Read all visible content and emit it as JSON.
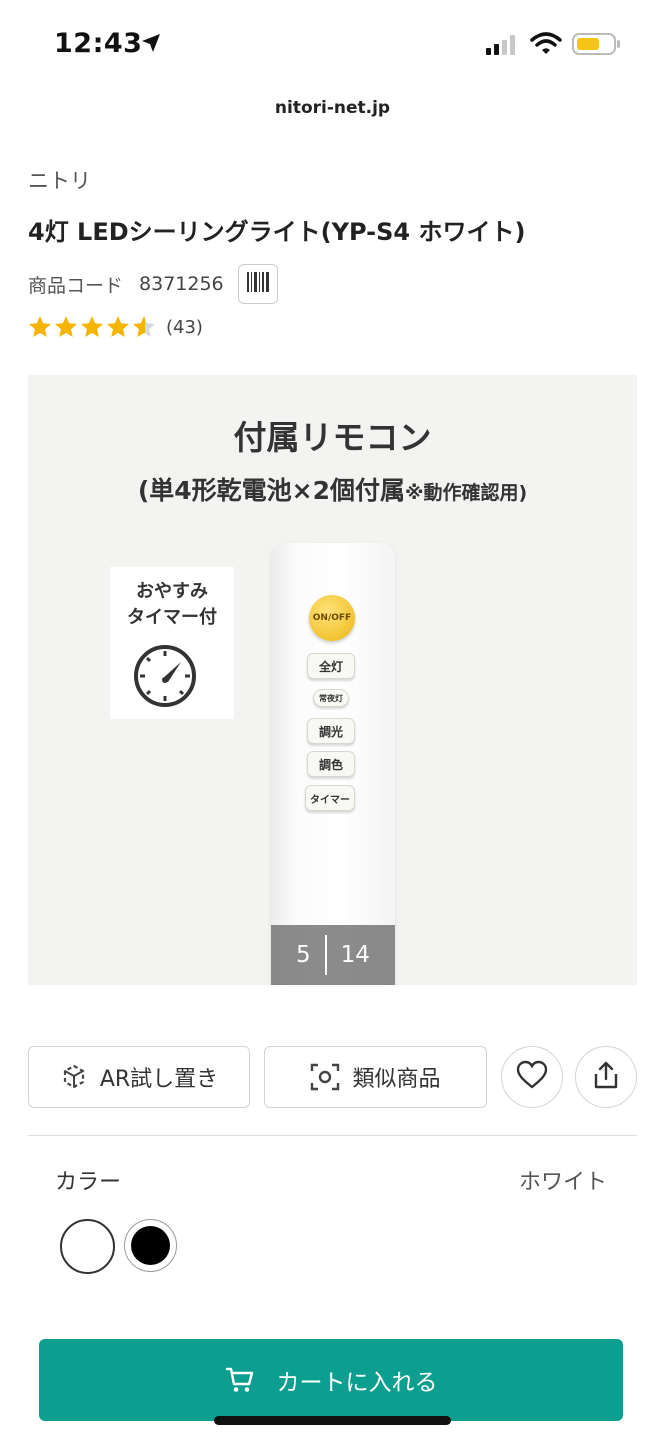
{
  "status_bar": {
    "time": "12:43",
    "icons": [
      "location-arrow-icon",
      "signal-icon",
      "wifi-icon",
      "battery-icon"
    ]
  },
  "browser": {
    "url": "nitori-net.jp"
  },
  "product": {
    "brand": "ニトリ",
    "title": "4灯 LEDシーリングライト(YP-S4 ホワイト)",
    "code_label": "商品コード",
    "code_value": "8371256",
    "rating": 4.5,
    "rating_count": "(43)"
  },
  "image": {
    "heading": "付属リモコン",
    "subheading": "(単4形乾電池×2個付属",
    "subheading_note": "※動作確認用)",
    "timer_badge_line1": "おやすみ",
    "timer_badge_line2": "タイマー付",
    "remote_buttons": {
      "on_off": "ON/OFF",
      "full": "全灯",
      "night": "常夜灯",
      "dimming": "調光",
      "color": "調色",
      "timer": "タイマー"
    },
    "current_index": "5",
    "total": "14"
  },
  "actions": {
    "ar_label": "AR試し置き",
    "similar_label": "類似商品"
  },
  "color": {
    "label": "カラー",
    "selected": "ホワイト",
    "swatches": [
      {
        "name": "white",
        "hex": "#ffffff",
        "selected": true
      },
      {
        "name": "black",
        "hex": "#000000",
        "selected": false
      }
    ]
  },
  "cart": {
    "label": "カートに入れる"
  },
  "colors": {
    "accent": "#0c9f8f",
    "star": "#f5b400",
    "battery": "#f5c518"
  }
}
